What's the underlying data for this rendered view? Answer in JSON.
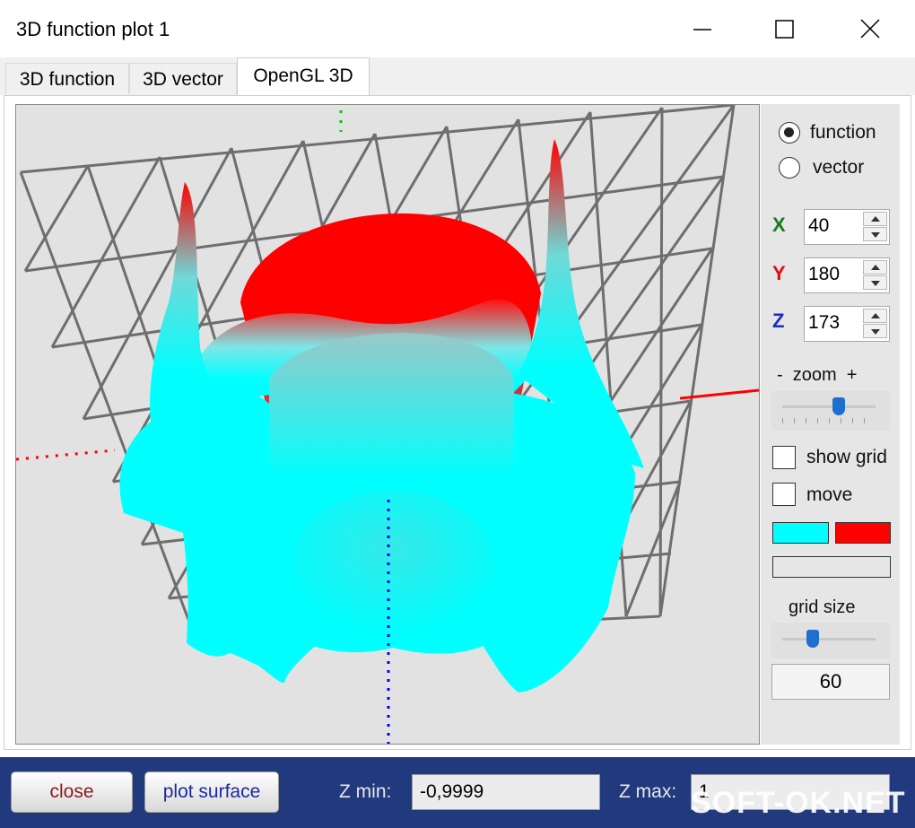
{
  "window": {
    "title": "3D function plot 1",
    "controls": [
      "minimize",
      "maximize",
      "close"
    ]
  },
  "tabs": [
    {
      "label": "3D function",
      "active": false
    },
    {
      "label": "3D vector",
      "active": false
    },
    {
      "label": "OpenGL 3D",
      "active": true
    }
  ],
  "viewport": {
    "icon": "3d-surface-render",
    "surface_colors": {
      "low": "#00ffff",
      "high": "#ff0000"
    },
    "grid_color": "#6e6e6e",
    "axis_colors": {
      "x": "#ff0000",
      "y": "#00cc00",
      "z": "#0000ff"
    }
  },
  "side": {
    "mode_options": [
      "function",
      "vector"
    ],
    "selected_mode": "function",
    "x_label": "X",
    "x_value": "40",
    "y_label": "Y",
    "y_value": "180",
    "z_label": "Z",
    "z_value": "173",
    "zoom_label": "-  zoom  +",
    "zoom_level_fraction": 0.62,
    "show_grid_label": "show grid",
    "show_grid_checked": false,
    "move_label": "move",
    "move_checked": false,
    "color1": "#00ffff",
    "color2": "#ff0000",
    "color3": "#e6e6e6",
    "grid_size_label": "grid size",
    "grid_size_fraction": 0.3,
    "grid_size_value": "60",
    "axis_label_colors": {
      "x": "#1a7a1a",
      "y": "#e01010",
      "z": "#1a2ad0"
    }
  },
  "bottom": {
    "close_label": "close",
    "plot_label": "plot surface",
    "zmin_label": "Z min:",
    "zmin_value": "-0,9999",
    "zmax_label": "Z max:",
    "zmax_value": "1"
  },
  "watermark": "SOFT-OK.NET"
}
